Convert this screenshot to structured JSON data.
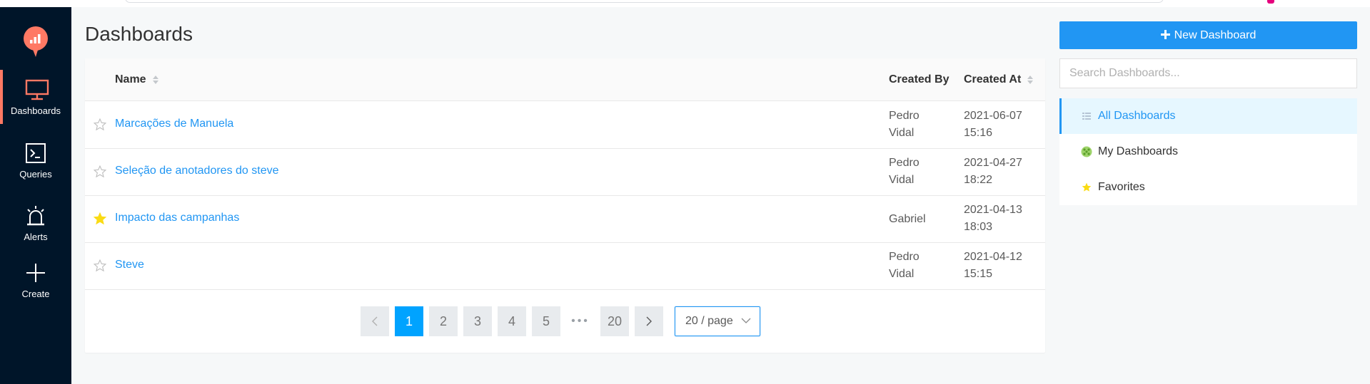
{
  "sidebar": {
    "items": [
      {
        "label": "Dashboards",
        "icon": "monitor-icon",
        "active": true
      },
      {
        "label": "Queries",
        "icon": "terminal-icon",
        "active": false
      },
      {
        "label": "Alerts",
        "icon": "alarm-icon",
        "active": false
      },
      {
        "label": "Create",
        "icon": "plus-icon",
        "active": false
      }
    ]
  },
  "main": {
    "title": "Dashboards",
    "columns": {
      "name": "Name",
      "created_by": "Created By",
      "created_at": "Created At"
    },
    "rows": [
      {
        "name": "Marcações de Manuela",
        "created_by_1": "Pedro",
        "created_by_2": "Vidal",
        "date": "2021-06-07",
        "time": "15:16",
        "favorite": false
      },
      {
        "name": "Seleção de anotadores do steve",
        "created_by_1": "Pedro",
        "created_by_2": "Vidal",
        "date": "2021-04-27",
        "time": "18:22",
        "favorite": false
      },
      {
        "name": "Impacto das campanhas",
        "created_by_1": "Gabriel",
        "created_by_2": "",
        "date": "2021-04-13",
        "time": "18:03",
        "favorite": true
      },
      {
        "name": "Steve",
        "created_by_1": "Pedro",
        "created_by_2": "Vidal",
        "date": "2021-04-12",
        "time": "15:15",
        "favorite": false
      }
    ],
    "pagination": {
      "pages": [
        "1",
        "2",
        "3",
        "4",
        "5"
      ],
      "ellipsis": "•••",
      "last_page": "20",
      "current": "1",
      "page_size": "20 / page"
    }
  },
  "right_panel": {
    "new_button_label": "New Dashboard",
    "search_placeholder": "Search Dashboards...",
    "menu": [
      {
        "label": "All Dashboards",
        "icon": "list-icon",
        "active": true
      },
      {
        "label": "My Dashboards",
        "icon": "user-icon",
        "active": false
      },
      {
        "label": "Favorites",
        "icon": "star-icon",
        "active": false
      }
    ]
  },
  "colors": {
    "sidebar_bg": "#001529",
    "accent": "#2196f3",
    "brand": "#ff7964",
    "star_active": "#fadb14",
    "page_active": "#00a3ff"
  }
}
